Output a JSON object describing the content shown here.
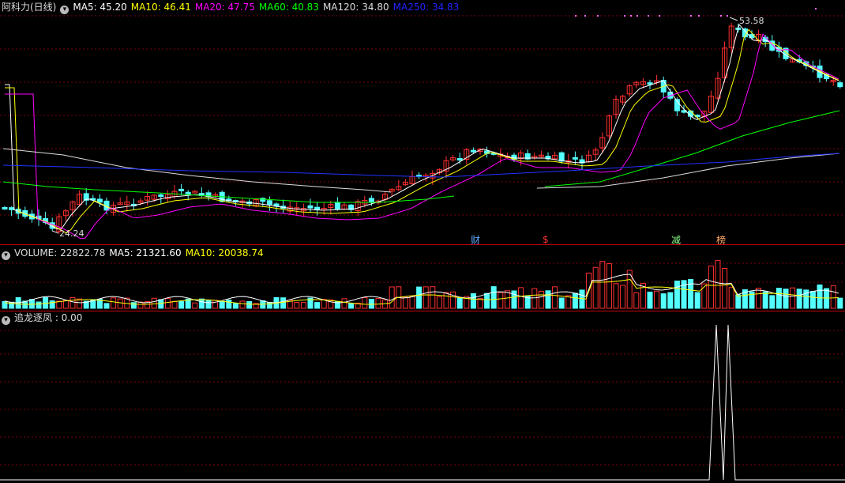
{
  "main": {
    "title": "阿科力(日线)",
    "ma": [
      {
        "label": "MA5: 45.20",
        "color": "#ffffff"
      },
      {
        "label": "MA10: 46.41",
        "color": "#ffff00"
      },
      {
        "label": "MA20: 47.75",
        "color": "#ff00ff"
      },
      {
        "label": "MA60: 40.83",
        "color": "#00ff00"
      },
      {
        "label": "MA120: 34.80",
        "color": "#dddddd"
      },
      {
        "label": "MA250: 34.83",
        "color": "#0000ff"
      }
    ],
    "high_label": "53.58",
    "low_label": "24.24",
    "markers": [
      {
        "text": "财",
        "color": "#5fa8ff"
      },
      {
        "text": "$",
        "color": "#ff3030"
      },
      {
        "text": "减",
        "color": "#88ff88"
      },
      {
        "text": "榜",
        "color": "#ffaa66"
      }
    ],
    "colors": {
      "up": "#ff3030",
      "down": "#54ffff",
      "bg": "#000000",
      "grid": "#7a0010"
    }
  },
  "volume": {
    "label": "VOLUME: 22822.78",
    "ma5": "MA5: 21321.60",
    "ma10": "MA10: 20038.74"
  },
  "indicator": {
    "label": "追龙逐凤 : 0.00"
  }
}
